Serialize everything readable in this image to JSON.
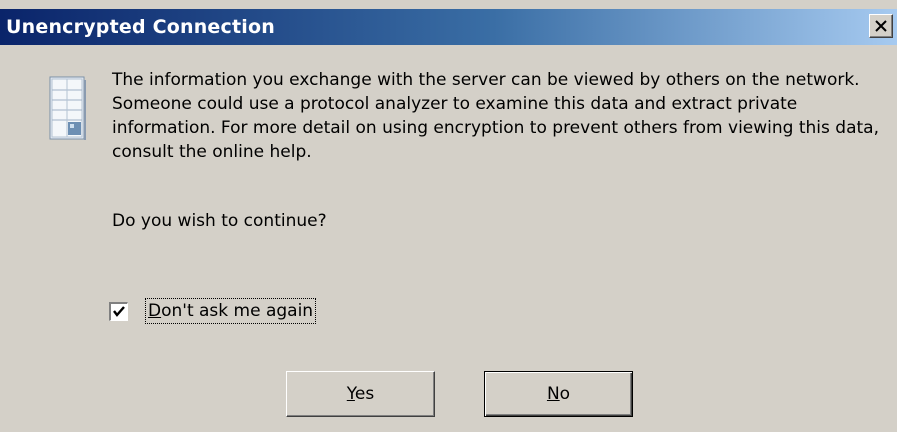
{
  "window": {
    "title": "Unencrypted Connection",
    "close_label": "Close"
  },
  "content": {
    "icon": "server-icon",
    "message": "The information you exchange with the server can be viewed by others on the network. Someone could use a protocol analyzer to examine this data and extract private information. For more detail on using encryption to prevent others from viewing this data, consult the online help.",
    "question": "Do you wish to continue?"
  },
  "checkbox": {
    "checked": true,
    "label_accel": "D",
    "label_rest": "on't ask me again"
  },
  "buttons": {
    "yes_accel": "Y",
    "yes_rest": "es",
    "no_accel": "N",
    "no_rest": "o"
  },
  "colors": {
    "titlebar_start": "#0a246a",
    "titlebar_end": "#a6caf0",
    "face": "#d4d0c8"
  }
}
